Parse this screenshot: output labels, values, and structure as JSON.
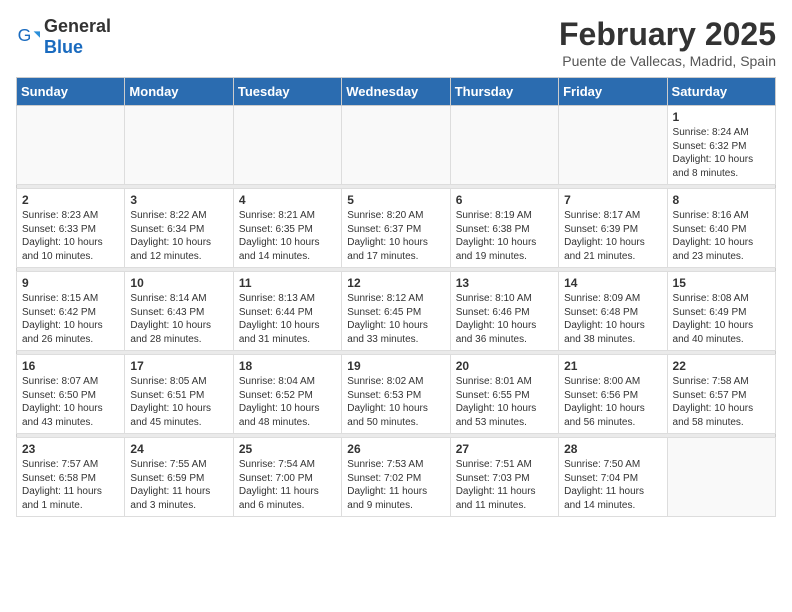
{
  "logo": {
    "general": "General",
    "blue": "Blue"
  },
  "title": "February 2025",
  "subtitle": "Puente de Vallecas, Madrid, Spain",
  "weekdays": [
    "Sunday",
    "Monday",
    "Tuesday",
    "Wednesday",
    "Thursday",
    "Friday",
    "Saturday"
  ],
  "weeks": [
    [
      {
        "day": "",
        "info": ""
      },
      {
        "day": "",
        "info": ""
      },
      {
        "day": "",
        "info": ""
      },
      {
        "day": "",
        "info": ""
      },
      {
        "day": "",
        "info": ""
      },
      {
        "day": "",
        "info": ""
      },
      {
        "day": "1",
        "info": "Sunrise: 8:24 AM\nSunset: 6:32 PM\nDaylight: 10 hours and 8 minutes."
      }
    ],
    [
      {
        "day": "2",
        "info": "Sunrise: 8:23 AM\nSunset: 6:33 PM\nDaylight: 10 hours and 10 minutes."
      },
      {
        "day": "3",
        "info": "Sunrise: 8:22 AM\nSunset: 6:34 PM\nDaylight: 10 hours and 12 minutes."
      },
      {
        "day": "4",
        "info": "Sunrise: 8:21 AM\nSunset: 6:35 PM\nDaylight: 10 hours and 14 minutes."
      },
      {
        "day": "5",
        "info": "Sunrise: 8:20 AM\nSunset: 6:37 PM\nDaylight: 10 hours and 17 minutes."
      },
      {
        "day": "6",
        "info": "Sunrise: 8:19 AM\nSunset: 6:38 PM\nDaylight: 10 hours and 19 minutes."
      },
      {
        "day": "7",
        "info": "Sunrise: 8:17 AM\nSunset: 6:39 PM\nDaylight: 10 hours and 21 minutes."
      },
      {
        "day": "8",
        "info": "Sunrise: 8:16 AM\nSunset: 6:40 PM\nDaylight: 10 hours and 23 minutes."
      }
    ],
    [
      {
        "day": "9",
        "info": "Sunrise: 8:15 AM\nSunset: 6:42 PM\nDaylight: 10 hours and 26 minutes."
      },
      {
        "day": "10",
        "info": "Sunrise: 8:14 AM\nSunset: 6:43 PM\nDaylight: 10 hours and 28 minutes."
      },
      {
        "day": "11",
        "info": "Sunrise: 8:13 AM\nSunset: 6:44 PM\nDaylight: 10 hours and 31 minutes."
      },
      {
        "day": "12",
        "info": "Sunrise: 8:12 AM\nSunset: 6:45 PM\nDaylight: 10 hours and 33 minutes."
      },
      {
        "day": "13",
        "info": "Sunrise: 8:10 AM\nSunset: 6:46 PM\nDaylight: 10 hours and 36 minutes."
      },
      {
        "day": "14",
        "info": "Sunrise: 8:09 AM\nSunset: 6:48 PM\nDaylight: 10 hours and 38 minutes."
      },
      {
        "day": "15",
        "info": "Sunrise: 8:08 AM\nSunset: 6:49 PM\nDaylight: 10 hours and 40 minutes."
      }
    ],
    [
      {
        "day": "16",
        "info": "Sunrise: 8:07 AM\nSunset: 6:50 PM\nDaylight: 10 hours and 43 minutes."
      },
      {
        "day": "17",
        "info": "Sunrise: 8:05 AM\nSunset: 6:51 PM\nDaylight: 10 hours and 45 minutes."
      },
      {
        "day": "18",
        "info": "Sunrise: 8:04 AM\nSunset: 6:52 PM\nDaylight: 10 hours and 48 minutes."
      },
      {
        "day": "19",
        "info": "Sunrise: 8:02 AM\nSunset: 6:53 PM\nDaylight: 10 hours and 50 minutes."
      },
      {
        "day": "20",
        "info": "Sunrise: 8:01 AM\nSunset: 6:55 PM\nDaylight: 10 hours and 53 minutes."
      },
      {
        "day": "21",
        "info": "Sunrise: 8:00 AM\nSunset: 6:56 PM\nDaylight: 10 hours and 56 minutes."
      },
      {
        "day": "22",
        "info": "Sunrise: 7:58 AM\nSunset: 6:57 PM\nDaylight: 10 hours and 58 minutes."
      }
    ],
    [
      {
        "day": "23",
        "info": "Sunrise: 7:57 AM\nSunset: 6:58 PM\nDaylight: 11 hours and 1 minute."
      },
      {
        "day": "24",
        "info": "Sunrise: 7:55 AM\nSunset: 6:59 PM\nDaylight: 11 hours and 3 minutes."
      },
      {
        "day": "25",
        "info": "Sunrise: 7:54 AM\nSunset: 7:00 PM\nDaylight: 11 hours and 6 minutes."
      },
      {
        "day": "26",
        "info": "Sunrise: 7:53 AM\nSunset: 7:02 PM\nDaylight: 11 hours and 9 minutes."
      },
      {
        "day": "27",
        "info": "Sunrise: 7:51 AM\nSunset: 7:03 PM\nDaylight: 11 hours and 11 minutes."
      },
      {
        "day": "28",
        "info": "Sunrise: 7:50 AM\nSunset: 7:04 PM\nDaylight: 11 hours and 14 minutes."
      },
      {
        "day": "",
        "info": ""
      }
    ]
  ]
}
